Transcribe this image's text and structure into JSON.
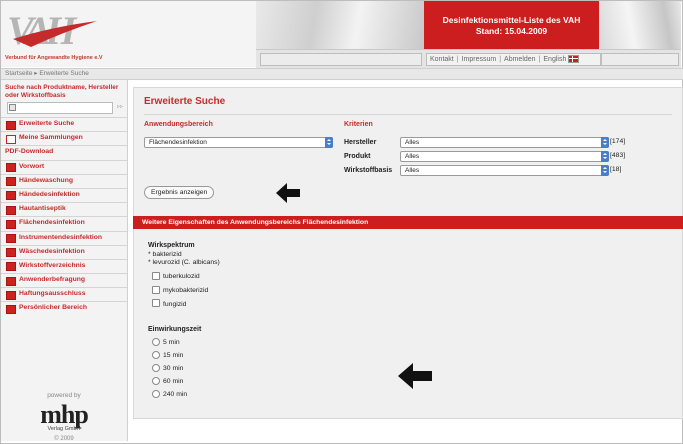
{
  "header": {
    "logo_text": "VAH",
    "logo_subtitle": "Verbund für Angewandte Hygiene e.V",
    "title_line1": "Desinfektionsmittel-Liste des VAH",
    "title_line2": "Stand: 15.04.2009",
    "nav": [
      "Kontakt",
      "Impressum",
      "Abmelden",
      "English"
    ]
  },
  "breadcrumb": "Startseite ▸ Erweiterte Suche",
  "sidebar": {
    "search_label": "Suche nach Produktname, Hersteller oder Wirkstoffbasis",
    "search_go": "▹▹",
    "items": [
      {
        "label": "Erweiterte Suche",
        "icon": "search-icon"
      },
      {
        "label": "Meine Sammlungen",
        "icon": "collection-icon"
      }
    ],
    "pdf_heading": "PDF-Download",
    "pdf_items": [
      "Vorwort",
      "Händewaschung",
      "Händedesinfektion",
      "Hautantiseptik",
      "Flächendesinfektion",
      "Instrumentendesinfektion",
      "Wäschedesinfektion",
      "Wirkstoffverzeichnis"
    ],
    "extra_items": [
      {
        "label": "Anwenderbefragung",
        "icon": "pencil-icon"
      },
      {
        "label": "Haftungsausschluss",
        "icon": "paragraph-icon"
      },
      {
        "label": "Persönlicher Bereich",
        "icon": "person-icon"
      }
    ],
    "powered_by": "powered by",
    "sponsor": "mhp",
    "sponsor_sub": "Verlag GmbH",
    "copyright": "© 2009"
  },
  "main": {
    "title": "Erweiterte Suche",
    "anwendungsbereich_label": "Anwendungsbereich",
    "anwendungsbereich_value": "Flächendesinfektion",
    "kriterien_label": "Kriterien",
    "criteria": [
      {
        "label": "Hersteller",
        "value": "Alles",
        "count": "[174]"
      },
      {
        "label": "Produkt",
        "value": "Alles",
        "count": "[483]"
      },
      {
        "label": "Wirkstoffbasis",
        "value": "Alles",
        "count": "[18]"
      }
    ],
    "button_label": "Ergebnis anzeigen",
    "section_bar": "Weitere Eigenschaften des Anwendungsbereichs Flächendesinfektion",
    "wirkspektrum_label": "Wirkspektrum",
    "wirkspektrum_fixed": [
      "* bakterizid",
      "* levurozid (C. albicans)"
    ],
    "wirkspektrum_options": [
      "tuberkulozid",
      "mykobakterizid",
      "fungizid"
    ],
    "einwirkungszeit_label": "Einwirkungszeit",
    "einwirkungszeit_options": [
      "5 min",
      "15 min",
      "30 min",
      "60 min",
      "240 min"
    ]
  },
  "colors": {
    "accent": "#cc1e1e",
    "select_arrow": "#4a7ec8"
  }
}
